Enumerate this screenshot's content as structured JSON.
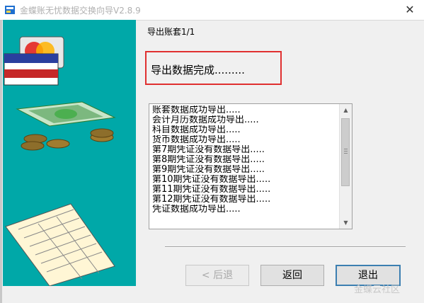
{
  "window": {
    "title": "金蝶账无忧数据交换向导V2.8.9",
    "close_glyph": "✕"
  },
  "header": {
    "text": "导出账套1/1"
  },
  "status": {
    "text": "导出数据完成.........",
    "highlight_color": "#e03030"
  },
  "log": {
    "lines": [
      "账套数据成功导出.....",
      "会计月历数据成功导出.....",
      "科目数据成功导出.....",
      "货币数据成功导出.....",
      "第7期凭证没有数据导出.....",
      "第8期凭证没有数据导出.....",
      "第9期凭证没有数据导出.....",
      "第10期凭证没有数据导出.....",
      "第11期凭证没有数据导出.....",
      "第12期凭证没有数据导出.....",
      "凭证数据成功导出....."
    ],
    "scroll_up_icon": "▲",
    "scroll_down_icon": "▼"
  },
  "buttons": {
    "back_label": "< 后退",
    "return_label": "返回",
    "exit_label": "退出"
  },
  "watermark": {
    "text": "金蝶云社区"
  },
  "colors": {
    "side_panel": "#00a8a8",
    "default_button_border": "#3c7fb1"
  }
}
